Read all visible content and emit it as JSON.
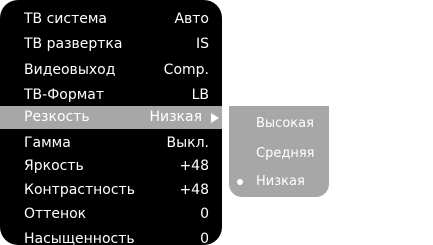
{
  "menu": {
    "items": [
      {
        "label": "ТВ система",
        "value": "Авто"
      },
      {
        "label": "ТВ развертка",
        "value": "IS"
      },
      {
        "label": "Видеовыход",
        "value": "Comp."
      },
      {
        "label": "ТВ-Формат",
        "value": "LB"
      },
      {
        "label": "Резкость",
        "value": "Низкая"
      },
      {
        "label": "Гамма",
        "value": "Выкл."
      },
      {
        "label": "Яркость",
        "value": "+48"
      },
      {
        "label": "Контрастность",
        "value": "+48"
      },
      {
        "label": "Оттенок",
        "value": "0"
      },
      {
        "label": "Насыщенность",
        "value": "0"
      }
    ],
    "selected_label": "Резкость"
  },
  "submenu": {
    "options": [
      {
        "label": "Высокая"
      },
      {
        "label": "Средняя"
      },
      {
        "label": "Низкая"
      }
    ],
    "selected_option": "Низкая"
  },
  "icons": {
    "submenu_arrow": "triangle-right-icon",
    "selected_marker": "bullet-dot-icon"
  },
  "colors": {
    "menu_background": "#000000",
    "highlight": "#a7a7a7",
    "text": "#ffffff"
  }
}
